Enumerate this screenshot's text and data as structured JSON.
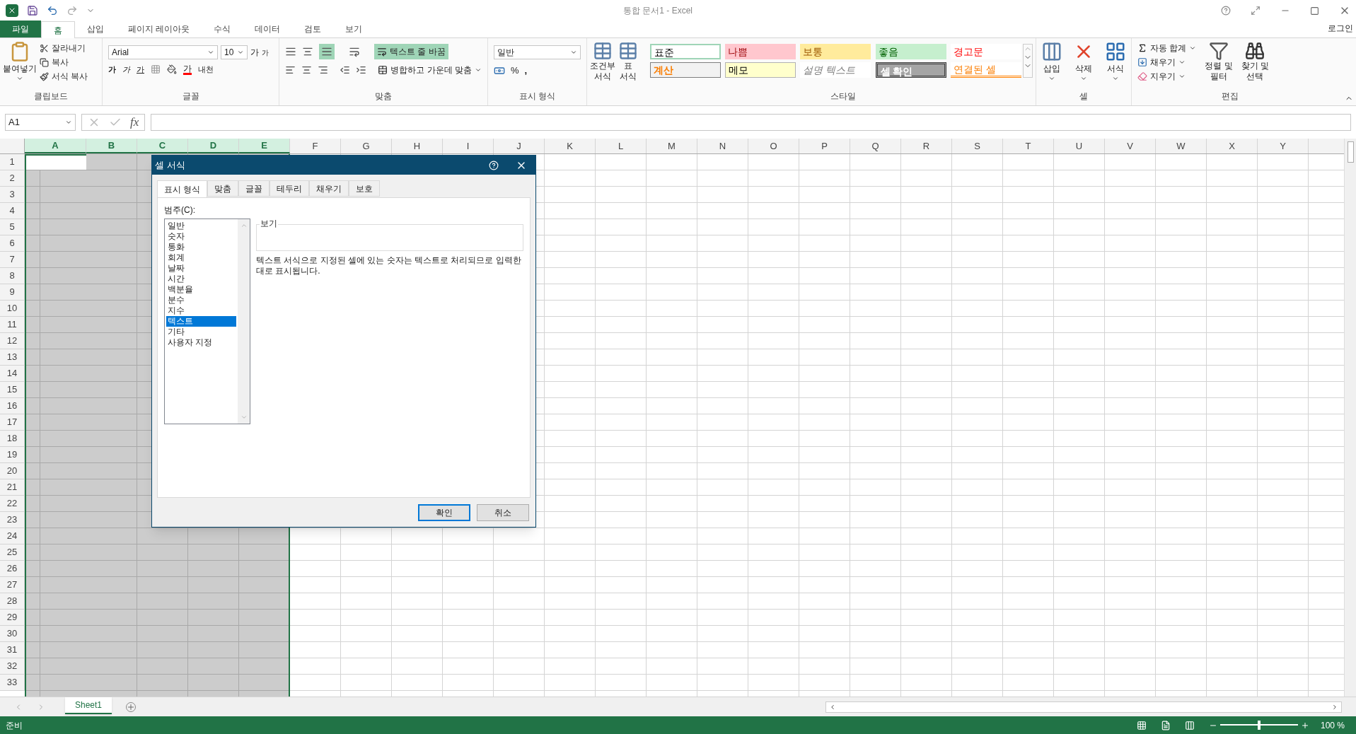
{
  "window": {
    "title": "통합 문서1 - Excel",
    "account": "로그인"
  },
  "ribbon": {
    "tabs": [
      {
        "label": "파일",
        "kind": "file",
        "selected": false
      },
      {
        "label": "홈",
        "kind": "tab",
        "selected": true
      },
      {
        "label": "삽입",
        "kind": "tab",
        "selected": false
      },
      {
        "label": "페이지 레이아웃",
        "kind": "tab",
        "selected": false
      },
      {
        "label": "수식",
        "kind": "tab",
        "selected": false
      },
      {
        "label": "데이터",
        "kind": "tab",
        "selected": false
      },
      {
        "label": "검토",
        "kind": "tab",
        "selected": false
      },
      {
        "label": "보기",
        "kind": "tab",
        "selected": false
      }
    ],
    "clipboard": {
      "label": "클립보드",
      "paste": "붙여넣기",
      "items": [
        "잘라내기",
        "복사",
        "서식 복사"
      ]
    },
    "font": {
      "label": "글꼴",
      "font_name": "Arial",
      "font_size": "10",
      "grow": "가",
      "shrink": "가",
      "bold": "가",
      "italic": "가",
      "underline": "가",
      "font_color": "가",
      "phonetic": "내천"
    },
    "alignment": {
      "label": "맞춤",
      "bottom_align_on": true,
      "wrap": {
        "label": "텍스트 줄 바꿈",
        "on": true
      },
      "merge": "병합하고 가운데 맞춤"
    },
    "number": {
      "label": "표시 형식",
      "format": "일반",
      "percent": "%",
      "comma": ","
    },
    "tables": [
      {
        "lines": [
          "조건부",
          "서식"
        ]
      },
      {
        "lines": [
          "표",
          "서식"
        ]
      }
    ],
    "styles": {
      "label": "스타일",
      "items": [
        {
          "label": "표준",
          "kind": "normal"
        },
        {
          "label": "나쁨",
          "kind": "bad"
        },
        {
          "label": "보통",
          "kind": "neutral"
        },
        {
          "label": "좋음",
          "kind": "good"
        },
        {
          "label": "경고문",
          "kind": "warning"
        },
        {
          "label": "계산",
          "kind": "calc"
        },
        {
          "label": "메모",
          "kind": "note"
        },
        {
          "label": "설명 텍스트",
          "kind": "explanatory"
        },
        {
          "label": "셀 확인",
          "kind": "check"
        },
        {
          "label": "연결된 셀",
          "kind": "linked"
        }
      ]
    },
    "cells": {
      "label": "셀",
      "items": [
        {
          "label": "삽입",
          "kind": "insert"
        },
        {
          "label": "삭제",
          "kind": "delete"
        },
        {
          "label": "서식",
          "kind": "format"
        }
      ]
    },
    "editing": {
      "label": "편집",
      "items": [
        {
          "label": "자동 합계",
          "kind": "sum"
        },
        {
          "label": "채우기",
          "kind": "fill"
        },
        {
          "label": "지우기",
          "kind": "clear"
        }
      ],
      "big": [
        {
          "lines": [
            "정렬 및",
            "필터"
          ],
          "kind": "sort"
        },
        {
          "lines": [
            "찾기 및",
            "선택"
          ],
          "kind": "find"
        }
      ]
    }
  },
  "formula_bar": {
    "name_box": "A1",
    "fx": "fx"
  },
  "sheet": {
    "columns": [
      {
        "label": "A",
        "selected": true,
        "active": true
      },
      {
        "label": "B",
        "selected": true,
        "active": false
      },
      {
        "label": "C",
        "selected": true,
        "active": false
      },
      {
        "label": "D",
        "selected": true,
        "active": false
      },
      {
        "label": "E",
        "selected": true,
        "active": false
      },
      {
        "label": "F",
        "selected": false,
        "active": false
      },
      {
        "label": "G",
        "selected": false,
        "active": false
      },
      {
        "label": "H",
        "selected": false,
        "active": false
      },
      {
        "label": "I",
        "selected": false,
        "active": false
      },
      {
        "label": "J",
        "selected": false,
        "active": false
      },
      {
        "label": "K",
        "selected": false,
        "active": false
      },
      {
        "label": "L",
        "selected": false,
        "active": false
      },
      {
        "label": "M",
        "selected": false,
        "active": false
      },
      {
        "label": "N",
        "selected": false,
        "active": false
      },
      {
        "label": "O",
        "selected": false,
        "active": false
      },
      {
        "label": "P",
        "selected": false,
        "active": false
      },
      {
        "label": "Q",
        "selected": false,
        "active": false
      },
      {
        "label": "R",
        "selected": false,
        "active": false
      },
      {
        "label": "S",
        "selected": false,
        "active": false
      },
      {
        "label": "T",
        "selected": false,
        "active": false
      },
      {
        "label": "U",
        "selected": false,
        "active": false
      },
      {
        "label": "V",
        "selected": false,
        "active": false
      },
      {
        "label": "W",
        "selected": false,
        "active": false
      },
      {
        "label": "X",
        "selected": false,
        "active": false
      },
      {
        "label": "Y",
        "selected": false,
        "active": false
      }
    ],
    "rows": [
      "1",
      "2",
      "3",
      "4",
      "5",
      "6",
      "7",
      "8",
      "9",
      "10",
      "11",
      "12",
      "13",
      "14",
      "15",
      "16",
      "17",
      "18",
      "19",
      "20",
      "21",
      "22",
      "23",
      "24",
      "25",
      "26",
      "27",
      "28",
      "29",
      "30",
      "31",
      "32",
      "33"
    ]
  },
  "dialog": {
    "title": "셀 서식",
    "tabs": [
      {
        "label": "표시 형식",
        "selected": true
      },
      {
        "label": "맞춤",
        "selected": false
      },
      {
        "label": "글꼴",
        "selected": false
      },
      {
        "label": "테두리",
        "selected": false
      },
      {
        "label": "채우기",
        "selected": false
      },
      {
        "label": "보호",
        "selected": false
      }
    ],
    "category_label": "범주(C):",
    "categories": [
      {
        "label": "일반",
        "selected": false
      },
      {
        "label": "숫자",
        "selected": false
      },
      {
        "label": "통화",
        "selected": false
      },
      {
        "label": "회계",
        "selected": false
      },
      {
        "label": "날짜",
        "selected": false
      },
      {
        "label": "시간",
        "selected": false
      },
      {
        "label": "백분율",
        "selected": false
      },
      {
        "label": "분수",
        "selected": false
      },
      {
        "label": "지수",
        "selected": false
      },
      {
        "label": "텍스트",
        "selected": true
      },
      {
        "label": "기타",
        "selected": false
      },
      {
        "label": "사용자 지정",
        "selected": false
      }
    ],
    "sample_label": "보기",
    "description": "텍스트 서식으로 지정된 셀에 있는 숫자는 텍스트로 처리되므로 입력한 대로 표시됩니다.",
    "buttons": [
      {
        "label": "확인",
        "kind": "primary"
      },
      {
        "label": "취소",
        "kind": "default"
      }
    ]
  },
  "sheet_tabs": [
    {
      "label": "Sheet1",
      "selected": true
    }
  ],
  "status_bar": {
    "status": "준비",
    "zoom": "100 %",
    "zoom_level": {
      "level": 0.5
    }
  }
}
